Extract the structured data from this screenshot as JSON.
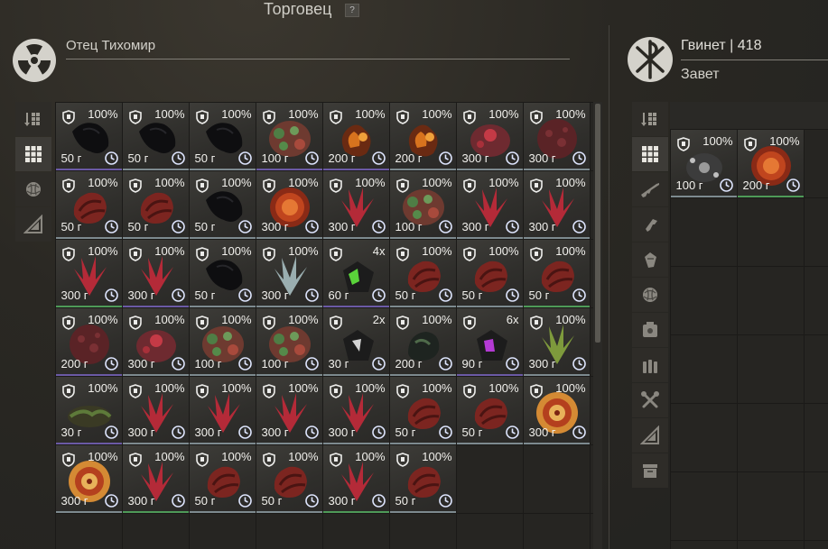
{
  "header": {
    "title": "Торговец",
    "help": "?"
  },
  "trader": {
    "name": "Отец Тихомир"
  },
  "player": {
    "name": "Гвинет | 418",
    "faction": "Завет"
  },
  "tab_icons_left": [
    "sort-list-icon",
    "grid-view-icon",
    "artifact-icon",
    "blueprint-icon"
  ],
  "tab_icons_right": [
    "sort-list-icon",
    "grid-view-icon",
    "rifle-icon",
    "pistol-icon",
    "armor-icon",
    "artifact-icon",
    "container-icon",
    "ammo-icon",
    "tools-icon",
    "blueprint-icon",
    "storage-box-icon"
  ],
  "colors": {
    "rare_green": "#4e9a58",
    "epic_purple": "#6b5aa5",
    "common": "#7d8a8f"
  },
  "trader_items": [
    {
      "pct": "100%",
      "price": "50 г",
      "art": "black",
      "rarity": "purple"
    },
    {
      "pct": "100%",
      "price": "50 г",
      "art": "black",
      "rarity": "common"
    },
    {
      "pct": "100%",
      "price": "50 г",
      "art": "black",
      "rarity": "common"
    },
    {
      "pct": "100%",
      "price": "100 г",
      "art": "greenred",
      "rarity": "purple"
    },
    {
      "pct": "100%",
      "price": "200 г",
      "art": "orange",
      "rarity": "purple"
    },
    {
      "pct": "100%",
      "price": "200 г",
      "art": "orange",
      "rarity": "common"
    },
    {
      "pct": "100%",
      "price": "300 г",
      "art": "redblob",
      "rarity": "common"
    },
    {
      "pct": "100%",
      "price": "300 г",
      "art": "darkred",
      "rarity": "common"
    },
    {
      "pct": "100%",
      "price": "50 г",
      "art": "redshell",
      "rarity": "common"
    },
    {
      "pct": "100%",
      "price": "50 г",
      "art": "redshell",
      "rarity": "common"
    },
    {
      "pct": "100%",
      "price": "50 г",
      "art": "black",
      "rarity": "common"
    },
    {
      "pct": "100%",
      "price": "300 г",
      "art": "fireball",
      "rarity": "common"
    },
    {
      "pct": "100%",
      "price": "300 г",
      "art": "crystal",
      "rarity": "common"
    },
    {
      "pct": "100%",
      "price": "100 г",
      "art": "greenred",
      "rarity": "common"
    },
    {
      "pct": "100%",
      "price": "300 г",
      "art": "crystal",
      "rarity": "common"
    },
    {
      "pct": "100%",
      "price": "300 г",
      "art": "crystal",
      "rarity": "common"
    },
    {
      "pct": "100%",
      "price": "300 г",
      "art": "crystal",
      "rarity": "green"
    },
    {
      "pct": "100%",
      "price": "300 г",
      "art": "crystal",
      "rarity": "purple"
    },
    {
      "pct": "100%",
      "price": "50 г",
      "art": "black",
      "rarity": "common"
    },
    {
      "pct": "100%",
      "price": "300 г",
      "art": "icecrystal",
      "rarity": "common"
    },
    {
      "pct": "4x",
      "price": "60 г",
      "art": "greenore",
      "rarity": "purple"
    },
    {
      "pct": "100%",
      "price": "50 г",
      "art": "redshell",
      "rarity": "common"
    },
    {
      "pct": "100%",
      "price": "50 г",
      "art": "redshell",
      "rarity": "common"
    },
    {
      "pct": "100%",
      "price": "50 г",
      "art": "redshell",
      "rarity": "green"
    },
    {
      "pct": "100%",
      "price": "200 г",
      "art": "darkred",
      "rarity": "purple"
    },
    {
      "pct": "100%",
      "price": "300 г",
      "art": "redblob",
      "rarity": "common"
    },
    {
      "pct": "100%",
      "price": "100 г",
      "art": "greenred",
      "rarity": "common"
    },
    {
      "pct": "100%",
      "price": "100 г",
      "art": "greenred",
      "rarity": "common"
    },
    {
      "pct": "2x",
      "price": "30 г",
      "art": "whiteore",
      "rarity": "common"
    },
    {
      "pct": "100%",
      "price": "200 г",
      "art": "darkgreen",
      "rarity": "common"
    },
    {
      "pct": "6x",
      "price": "90 г",
      "art": "purpleore",
      "rarity": "purple"
    },
    {
      "pct": "100%",
      "price": "300 г",
      "art": "greencrystal",
      "rarity": "common"
    },
    {
      "pct": "100%",
      "price": "30 г",
      "art": "moss",
      "rarity": "purple"
    },
    {
      "pct": "100%",
      "price": "300 г",
      "art": "crystal",
      "rarity": "common"
    },
    {
      "pct": "100%",
      "price": "300 г",
      "art": "crystal",
      "rarity": "common"
    },
    {
      "pct": "100%",
      "price": "300 г",
      "art": "crystal",
      "rarity": "common"
    },
    {
      "pct": "100%",
      "price": "300 г",
      "art": "crystal",
      "rarity": "common"
    },
    {
      "pct": "100%",
      "price": "50 г",
      "art": "redshell",
      "rarity": "common"
    },
    {
      "pct": "100%",
      "price": "50 г",
      "art": "redshell",
      "rarity": "common"
    },
    {
      "pct": "100%",
      "price": "300 г",
      "art": "spiral",
      "rarity": "common"
    },
    {
      "pct": "100%",
      "price": "300 г",
      "art": "spiral",
      "rarity": "common"
    },
    {
      "pct": "100%",
      "price": "300 г",
      "art": "crystal",
      "rarity": "green"
    },
    {
      "pct": "100%",
      "price": "50 г",
      "art": "redshell",
      "rarity": "common"
    },
    {
      "pct": "100%",
      "price": "50 г",
      "art": "redshell",
      "rarity": "common"
    },
    {
      "pct": "100%",
      "price": "300 г",
      "art": "crystal",
      "rarity": "green"
    },
    {
      "pct": "100%",
      "price": "50 г",
      "art": "redshell",
      "rarity": "common"
    }
  ],
  "player_items": [
    {
      "pct": "100%",
      "price": "100 г",
      "art": "device",
      "rarity": "common"
    },
    {
      "pct": "100%",
      "price": "200 г",
      "art": "fireball",
      "rarity": "green"
    }
  ]
}
